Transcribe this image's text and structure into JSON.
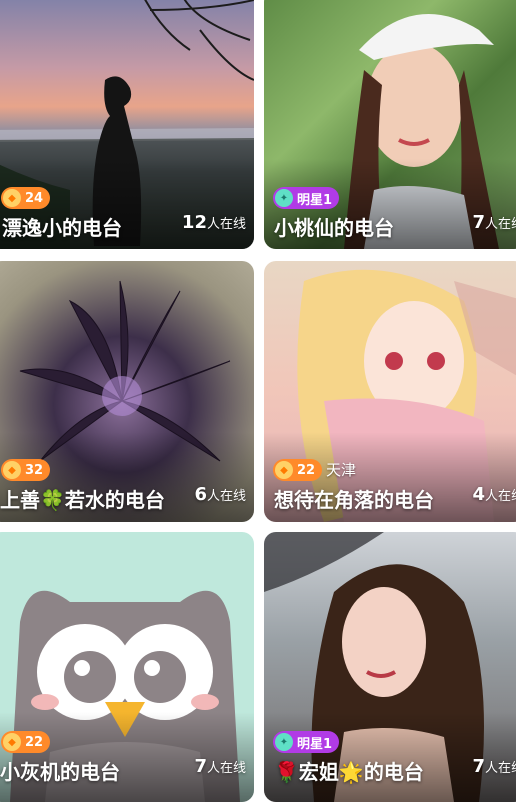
{
  "cards": [
    {
      "title": "漂逸小的电台",
      "online_count": "12",
      "online_suffix": "人在线",
      "badge_type": "level",
      "badge_text": "24",
      "location": ""
    },
    {
      "title": "小桃仙的电台",
      "online_count": "7",
      "online_suffix": "人在线",
      "badge_type": "star",
      "badge_text": "明星1",
      "location": ""
    },
    {
      "title_pre": "上善",
      "title_emoji": "🍀",
      "title_post": "若水的电台",
      "online_count": "6",
      "online_suffix": "人在线",
      "badge_type": "level",
      "badge_text": "32",
      "location": ""
    },
    {
      "title": "想待在角落的电台",
      "online_count": "4",
      "online_suffix": "人在线",
      "badge_type": "level",
      "badge_text": "22",
      "location": "天津"
    },
    {
      "title": "小灰机的电台",
      "online_count": "7",
      "online_suffix": "人在线",
      "badge_type": "level",
      "badge_text": "22",
      "location": ""
    },
    {
      "title_emoji_pre": "🌹",
      "title_mid": "宏姐",
      "title_emoji_mid": "🌟",
      "title_post": "的电台",
      "online_count": "7",
      "online_suffix": "人在线",
      "badge_type": "star",
      "badge_text": "明星1",
      "location": ""
    }
  ]
}
